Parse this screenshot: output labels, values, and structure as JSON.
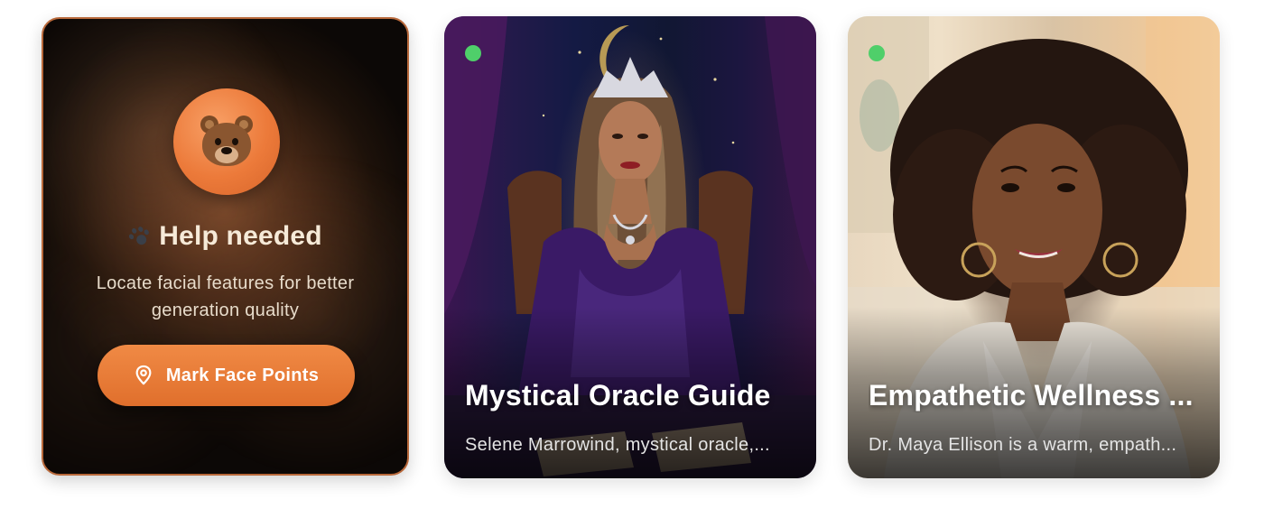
{
  "help_card": {
    "title": "Help needed",
    "description": "Locate facial features for better generation quality",
    "button_label": "Mark Face Points",
    "badge_icon": "bear-icon",
    "title_icon": "paw-icon",
    "button_icon": "location-pin-icon",
    "accent_color": "#e87a38"
  },
  "characters": [
    {
      "title": "Mystical Oracle Guide",
      "description": "Selene Marrowind, mystical oracle,...",
      "online": true
    },
    {
      "title": "Empathetic Wellness ...",
      "description": "Dr. Maya Ellison is a warm, empath...",
      "online": true
    }
  ],
  "status_color": "#4fcf6a"
}
